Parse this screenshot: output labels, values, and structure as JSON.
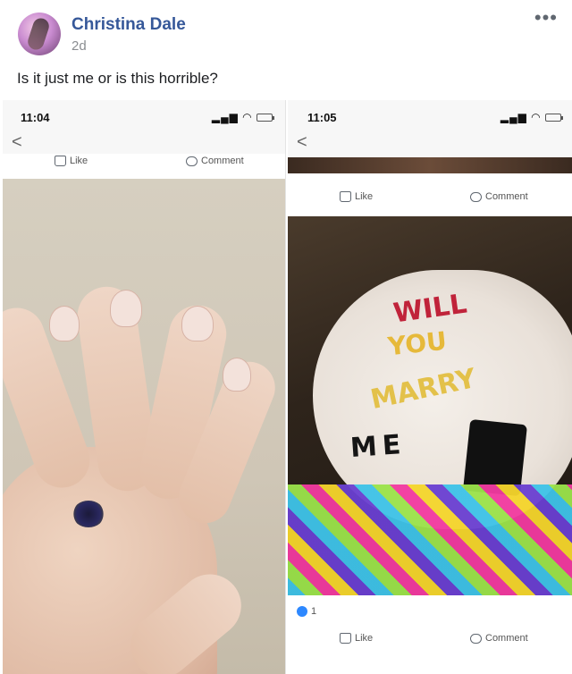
{
  "post": {
    "author": "Christina Dale",
    "time": "2d",
    "caption": "Is it just me or is this horrible?",
    "more_label": "•••"
  },
  "left_screenshot": {
    "clock": "11:04",
    "back_label": "<",
    "likebar": {
      "like": "Like",
      "comment": "Comment"
    },
    "photo": "hand-with-ring"
  },
  "right_screenshot": {
    "clock": "11:05",
    "back_label": "<",
    "likebar_top": {
      "like": "Like",
      "comment": "Comment"
    },
    "belly_text": [
      "WILL",
      "YOU",
      "MARRY",
      "ME"
    ],
    "reaction_count": "1",
    "likebar_bottom": {
      "like": "Like",
      "comment": "Comment"
    }
  },
  "colors": {
    "author_link": "#365899",
    "reaction_blue": "#2d88ff"
  }
}
